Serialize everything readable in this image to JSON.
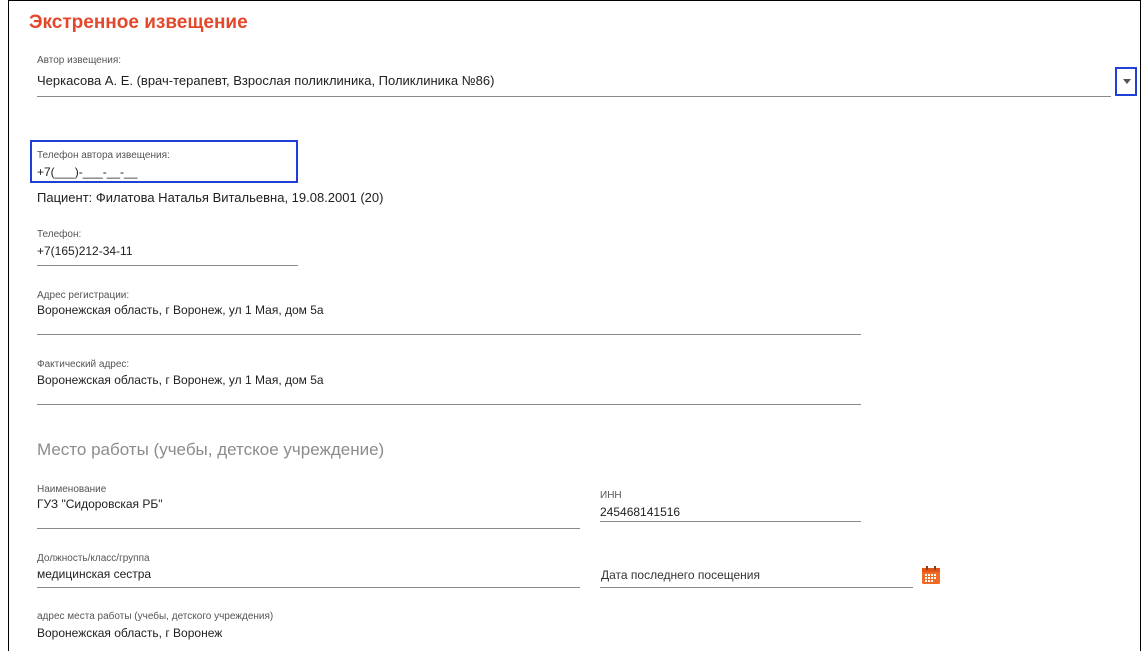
{
  "colors": {
    "title": "#e4472a",
    "focus_border": "#1f3fd6",
    "calendar_icon": "#f06a24"
  },
  "header": {
    "title": "Экстренное извещение"
  },
  "author": {
    "label": "Автор извещения:",
    "value": "Черкасова А. Е.  (врач-терапевт, Взрослая поликлиника, Поликлиника №86)",
    "dropdown_icon": "chevron-down-icon"
  },
  "author_phone": {
    "label": "Телефон автора извещения:",
    "value": "+7(___)-___-__-__"
  },
  "patient": {
    "text": "Пациент: Филатова Наталья Витальевна, 19.08.2001 (20)"
  },
  "phone": {
    "label": "Телефон:",
    "value": "+7(165)212-34-11"
  },
  "reg_address": {
    "label": "Адрес регистрации:",
    "value": "Воронежская область, г Воронеж, ул 1 Мая, дом 5а"
  },
  "actual_address": {
    "label": "Фактический адрес:",
    "value": "Воронежская область, г Воронеж, ул 1 Мая, дом 5а"
  },
  "workplace": {
    "section_title": "Место работы (учебы, детское учреждение)",
    "name_label": "Наименование",
    "name_value": "ГУЗ \"Сидоровская РБ\"",
    "inn_label": "ИНН",
    "inn_value": "245468141516",
    "position_label": "Должность/класс/группа",
    "position_value": "медицинская сестра",
    "last_visit_placeholder": "Дата последнего посещения",
    "calendar_icon": "calendar-icon",
    "address_label": "адрес места работы (учебы, детского учреждения)",
    "address_value": "Воронежская область, г Воронеж"
  }
}
